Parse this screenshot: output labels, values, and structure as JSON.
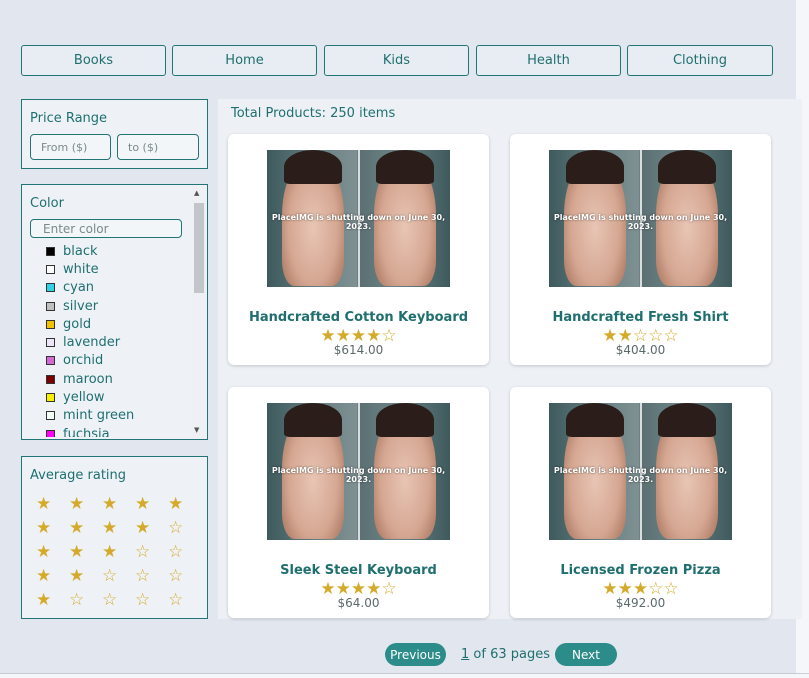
{
  "categories": [
    "Books",
    "Home",
    "Kids",
    "Health",
    "Clothing"
  ],
  "price_range": {
    "title": "Price Range",
    "from_placeholder": "From ($)",
    "to_placeholder": "to ($)"
  },
  "color_filter": {
    "title": "Color",
    "search_placeholder": "Enter color",
    "items": [
      {
        "label": "black",
        "swatch": "#000000"
      },
      {
        "label": "white",
        "swatch": "#ffffff"
      },
      {
        "label": "cyan",
        "swatch": "#2fd2e6"
      },
      {
        "label": "silver",
        "swatch": "#c0c0c0"
      },
      {
        "label": "gold",
        "swatch": "#f2c200"
      },
      {
        "label": "lavender",
        "swatch": "#eae6f8"
      },
      {
        "label": "orchid",
        "swatch": "#d26ad6"
      },
      {
        "label": "maroon",
        "swatch": "#7a0000"
      },
      {
        "label": "yellow",
        "swatch": "#f6f000"
      },
      {
        "label": "mint green",
        "swatch": "#f3fff6"
      },
      {
        "label": "fuchsia",
        "swatch": "#ff00ff"
      }
    ]
  },
  "rating_filter": {
    "title": "Average rating",
    "rows": [
      "★★★★★",
      "★★★★☆",
      "★★★☆☆",
      "★★☆☆☆",
      "★☆☆☆☆"
    ]
  },
  "products_summary": "Total Products: 250 items",
  "product_image_caption": "PlaceIMG is shutting down on June 30, 2023.",
  "products": [
    {
      "name": "Handcrafted Cotton Keyboard",
      "rating": "★★★★☆",
      "price": "$614.00"
    },
    {
      "name": "Handcrafted Fresh Shirt",
      "rating": "★★☆☆☆",
      "price": "$404.00"
    },
    {
      "name": "Sleek Steel Keyboard",
      "rating": "★★★★☆",
      "price": "$64.00"
    },
    {
      "name": "Licensed Frozen Pizza",
      "rating": "★★★☆☆",
      "price": "$492.00"
    }
  ],
  "pagination": {
    "previous_label": "Previous",
    "current_page": "1",
    "of_text": " of 63 pages",
    "next_label": "Next"
  },
  "colors": {
    "accent": "#1f6f6f",
    "button_fill": "#2b8c89",
    "star": "#d4aa2a",
    "page_bg": "#e2e7ef"
  }
}
